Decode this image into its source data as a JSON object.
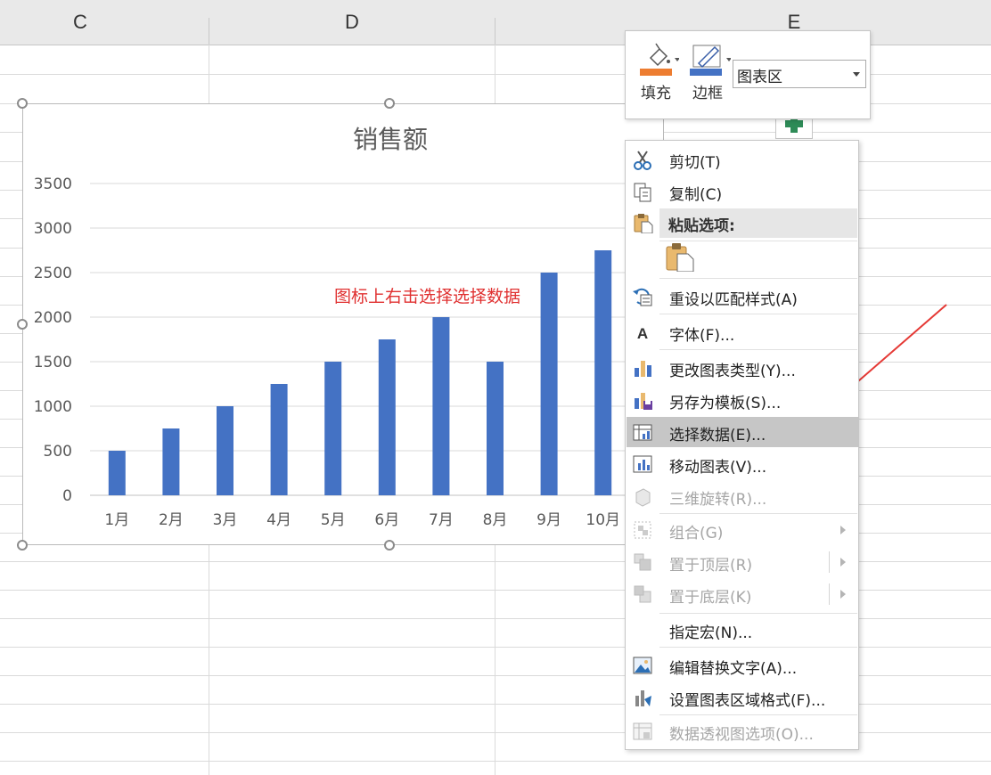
{
  "sheet": {
    "columns": [
      "C",
      "D",
      "E"
    ]
  },
  "chart": {
    "annotation": "图标上右击选择选择数据"
  },
  "chart_data": {
    "type": "bar",
    "title": "销售额",
    "categories": [
      "1月",
      "2月",
      "3月",
      "4月",
      "5月",
      "6月",
      "7月",
      "8月",
      "9月",
      "10月"
    ],
    "values": [
      500,
      750,
      1000,
      1250,
      1500,
      1750,
      2000,
      1500,
      2500,
      2750
    ],
    "yticks": [
      "0",
      "500",
      "1000",
      "1500",
      "2000",
      "2500",
      "3000",
      "3500"
    ],
    "ylim": [
      0,
      3500
    ],
    "grid": true,
    "bar_color": "#4472c4"
  },
  "minibar": {
    "fill_label": "填充",
    "border_label": "边框",
    "element_select": "图表区",
    "fill_color": "#ed7d31",
    "border_color": "#4472c4"
  },
  "context_menu": {
    "items": [
      {
        "label": "剪切(T)",
        "icon": "scissors-icon",
        "enabled": true
      },
      {
        "label": "复制(C)",
        "icon": "copy-icon",
        "enabled": true
      },
      {
        "label": "粘贴选项:",
        "icon": "paste-icon",
        "enabled": true
      },
      {
        "label": "重设以匹配样式(A)",
        "icon": "reset-style-icon",
        "enabled": true
      },
      {
        "label": "字体(F)...",
        "icon": "font-icon",
        "enabled": true
      },
      {
        "label": "更改图表类型(Y)...",
        "icon": "chart-type-icon",
        "enabled": true
      },
      {
        "label": "另存为模板(S)...",
        "icon": "save-template-icon",
        "enabled": true
      },
      {
        "label": "选择数据(E)...",
        "icon": "select-data-icon",
        "enabled": true,
        "highlighted": true
      },
      {
        "label": "移动图表(V)...",
        "icon": "move-chart-icon",
        "enabled": true
      },
      {
        "label": "三维旋转(R)...",
        "icon": "rotate-3d-icon",
        "enabled": false
      },
      {
        "label": "组合(G)",
        "icon": "group-icon",
        "enabled": false
      },
      {
        "label": "置于顶层(R)",
        "icon": "bring-front-icon",
        "enabled": false
      },
      {
        "label": "置于底层(K)",
        "icon": "send-back-icon",
        "enabled": false
      },
      {
        "label": "指定宏(N)...",
        "icon": "",
        "enabled": true
      },
      {
        "label": "编辑替换文字(A)...",
        "icon": "alt-text-icon",
        "enabled": true
      },
      {
        "label": "设置图表区域格式(F)...",
        "icon": "format-area-icon",
        "enabled": true
      },
      {
        "label": "数据透视图选项(O)...",
        "icon": "pivot-options-icon",
        "enabled": false
      }
    ]
  }
}
